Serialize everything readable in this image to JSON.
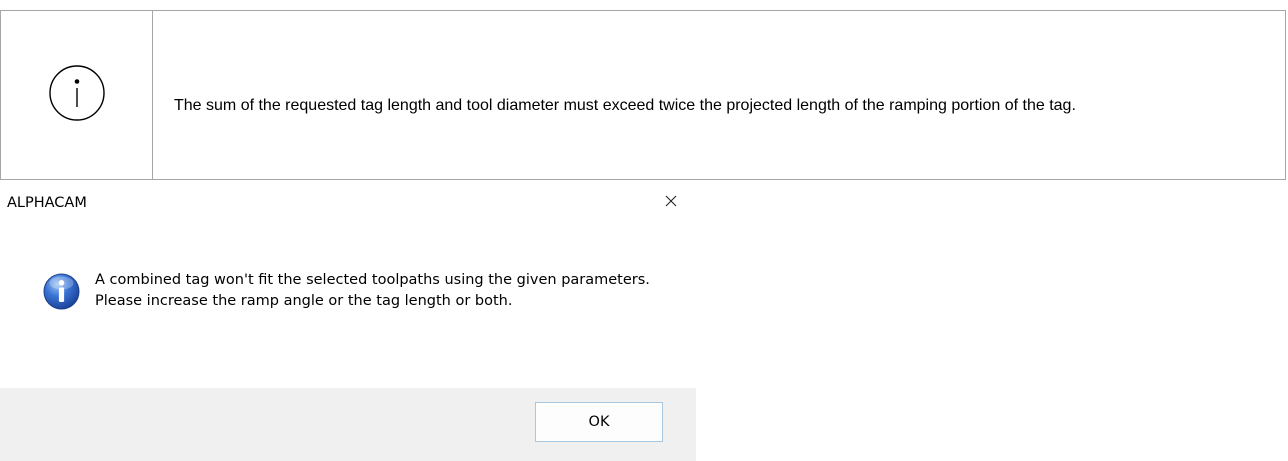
{
  "note": {
    "icon": "info-outline-icon",
    "text": "The sum of the requested tag length and tool diameter must exceed twice the projected length of the ramping portion of the tag."
  },
  "dialog": {
    "title": "ALPHACAM",
    "close_icon": "close-icon",
    "icon": "info-icon",
    "message": "A combined tag won't fit the selected toolpaths using the given parameters. Please increase the ramp angle or the tag length or both.",
    "ok_label": "OK"
  }
}
